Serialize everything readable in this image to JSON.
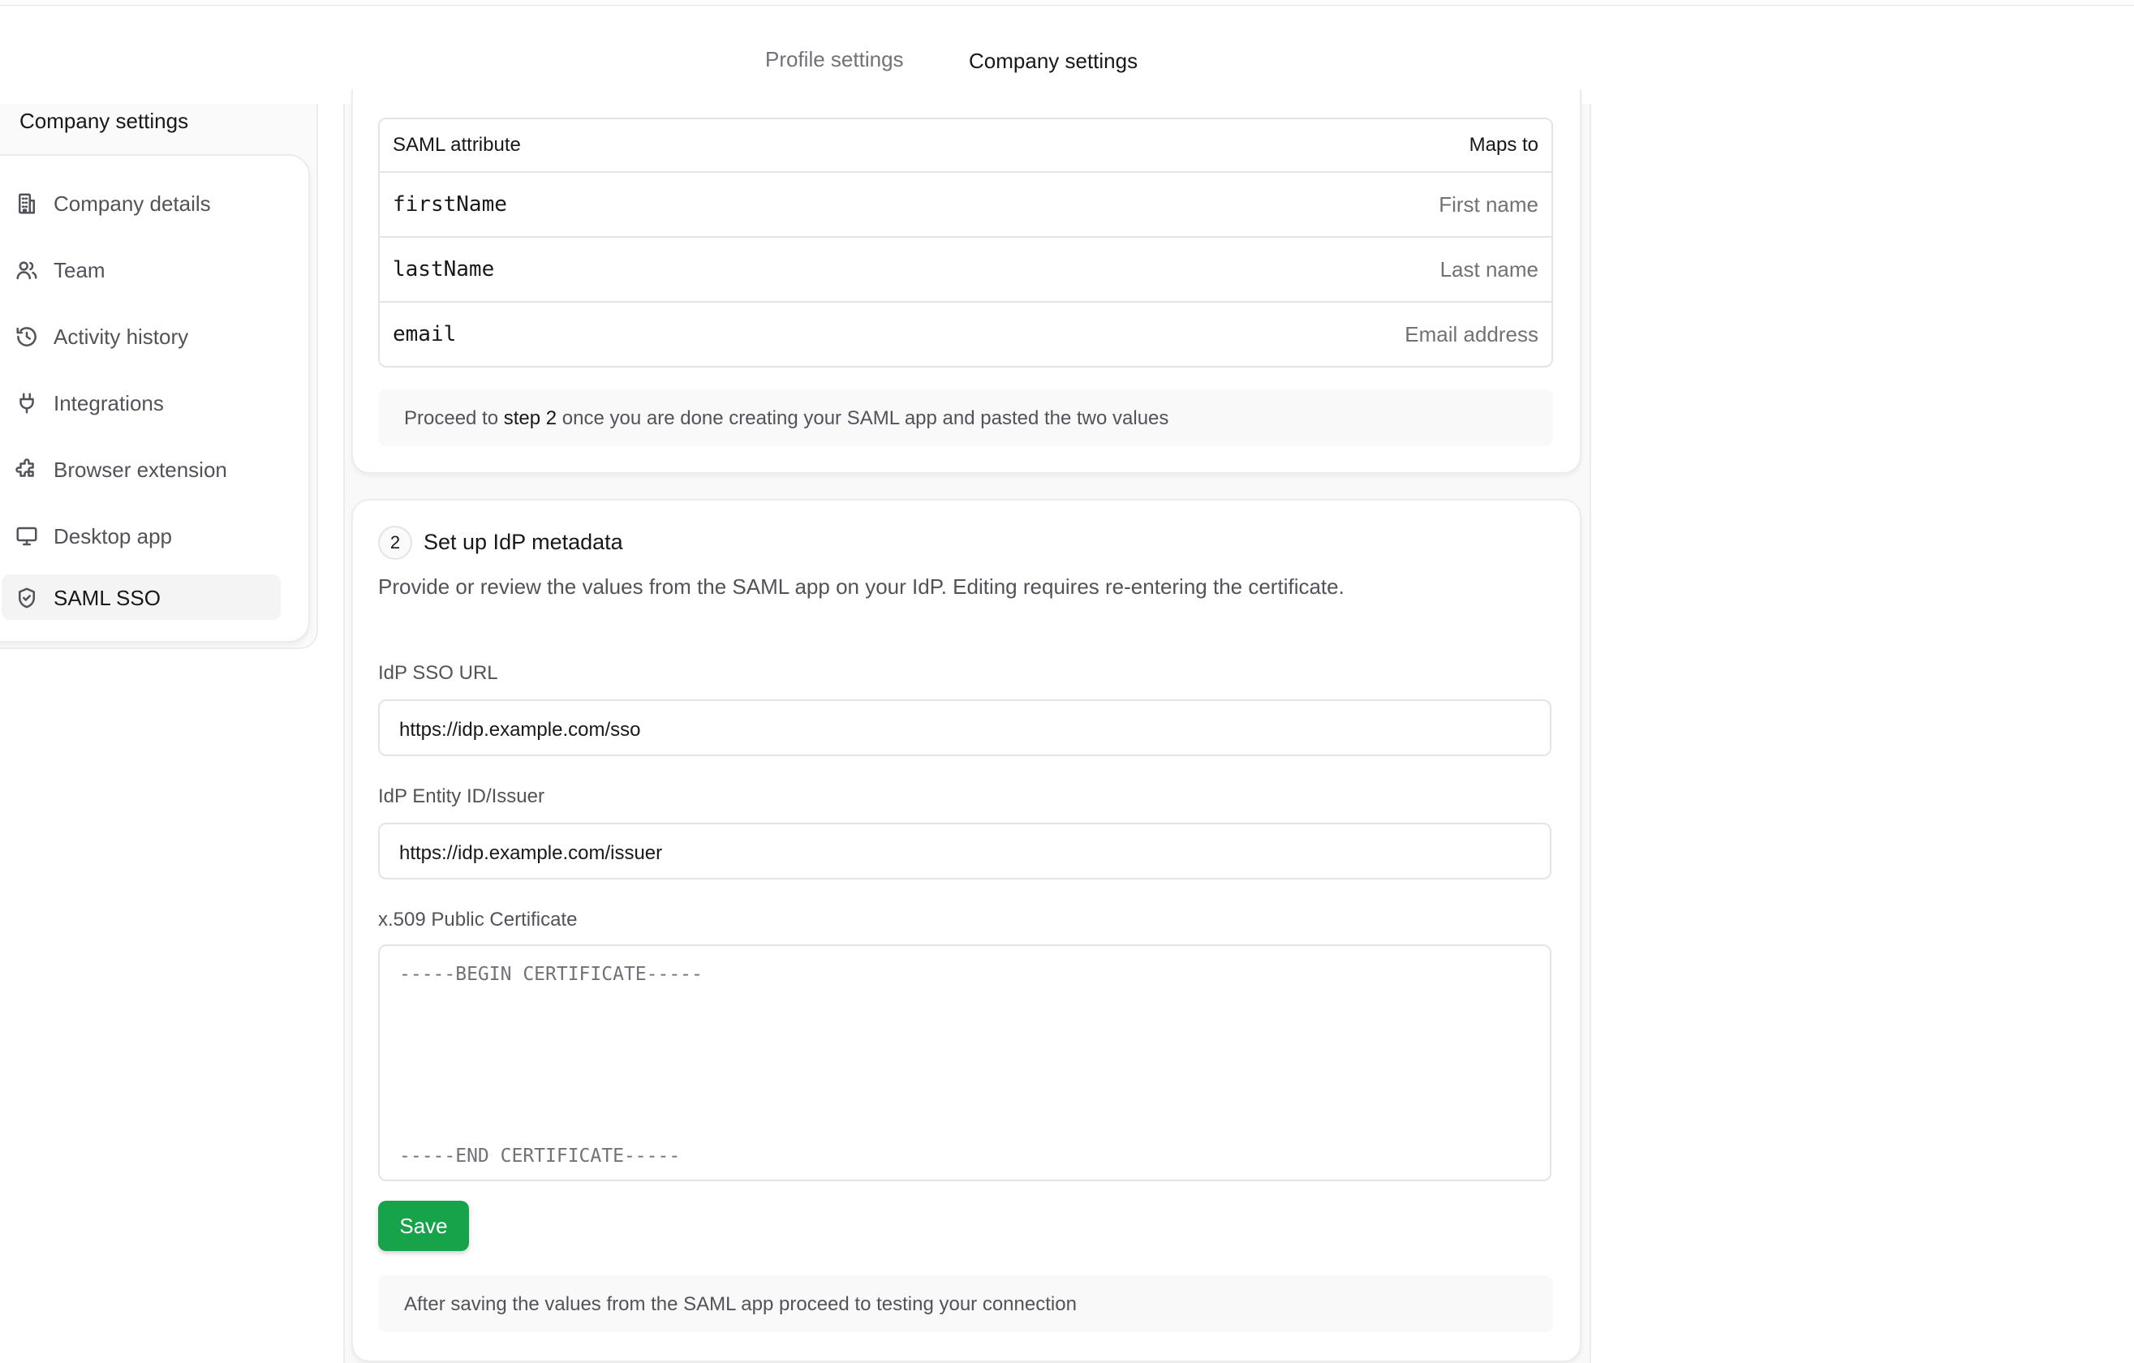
{
  "tabs": {
    "profile": "Profile settings",
    "company": "Company settings"
  },
  "sidebar": {
    "title": "Company settings",
    "items": [
      {
        "label": "Company details",
        "icon": "building-icon"
      },
      {
        "label": "Team",
        "icon": "users-icon"
      },
      {
        "label": "Activity history",
        "icon": "history-icon"
      },
      {
        "label": "Integrations",
        "icon": "plug-icon"
      },
      {
        "label": "Browser extension",
        "icon": "puzzle-icon"
      },
      {
        "label": "Desktop app",
        "icon": "monitor-icon"
      },
      {
        "label": "SAML SSO",
        "icon": "shield-check-icon",
        "active": true
      }
    ]
  },
  "attribute_map": {
    "headers": {
      "attribute": "SAML attribute",
      "maps_to": "Maps to"
    },
    "rows": [
      {
        "attribute": "firstName",
        "maps_to": "First name"
      },
      {
        "attribute": "lastName",
        "maps_to": "Last name"
      },
      {
        "attribute": "email",
        "maps_to": "Email address"
      }
    ]
  },
  "step1_note": {
    "prefix": "Proceed to ",
    "strong": "step 2",
    "suffix": " once you are done creating your SAML app and pasted the two values"
  },
  "step2": {
    "number": "2",
    "title": "Set up IdP metadata",
    "description": "Provide or review the values from the SAML app on your IdP. Editing requires re-entering the certificate.",
    "sso_url": {
      "label": "IdP SSO URL",
      "value": "https://idp.example.com/sso"
    },
    "entity_id": {
      "label": "IdP Entity ID/Issuer",
      "value": "https://idp.example.com/issuer"
    },
    "certificate": {
      "label": "x.509 Public Certificate",
      "begin": "-----BEGIN CERTIFICATE-----",
      "end": "-----END CERTIFICATE-----"
    },
    "save_label": "Save",
    "note": "After saving the values from the SAML app proceed to testing your connection"
  },
  "colors": {
    "accent": "#16a34a",
    "text": "#18181b",
    "muted": "#52525b",
    "border": "#e4e4e7"
  }
}
